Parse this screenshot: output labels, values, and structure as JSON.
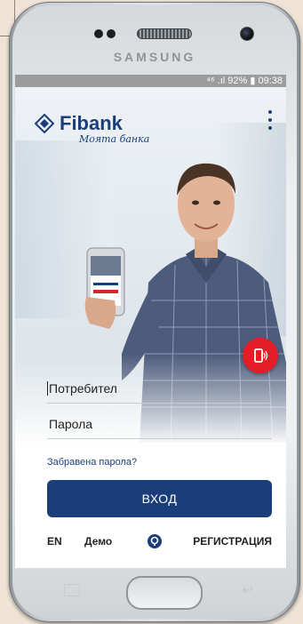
{
  "device": {
    "brand": "SAMSUNG"
  },
  "status_bar": {
    "text": "⁴⁶ .ıl 92% ▮ 09:38"
  },
  "app": {
    "logo_text": "Fibank",
    "logo_subtitle": "Моята банка"
  },
  "form": {
    "username_placeholder": "Потребител",
    "password_placeholder": "Парола",
    "forgot_password": "Забравена парола?",
    "login_label": "ВХОД"
  },
  "footer": {
    "language": "EN",
    "demo": "Демо",
    "register": "РЕГИСТРАЦИЯ"
  },
  "colors": {
    "brand_blue": "#1b3e7a",
    "accent_red": "#e41e26"
  }
}
